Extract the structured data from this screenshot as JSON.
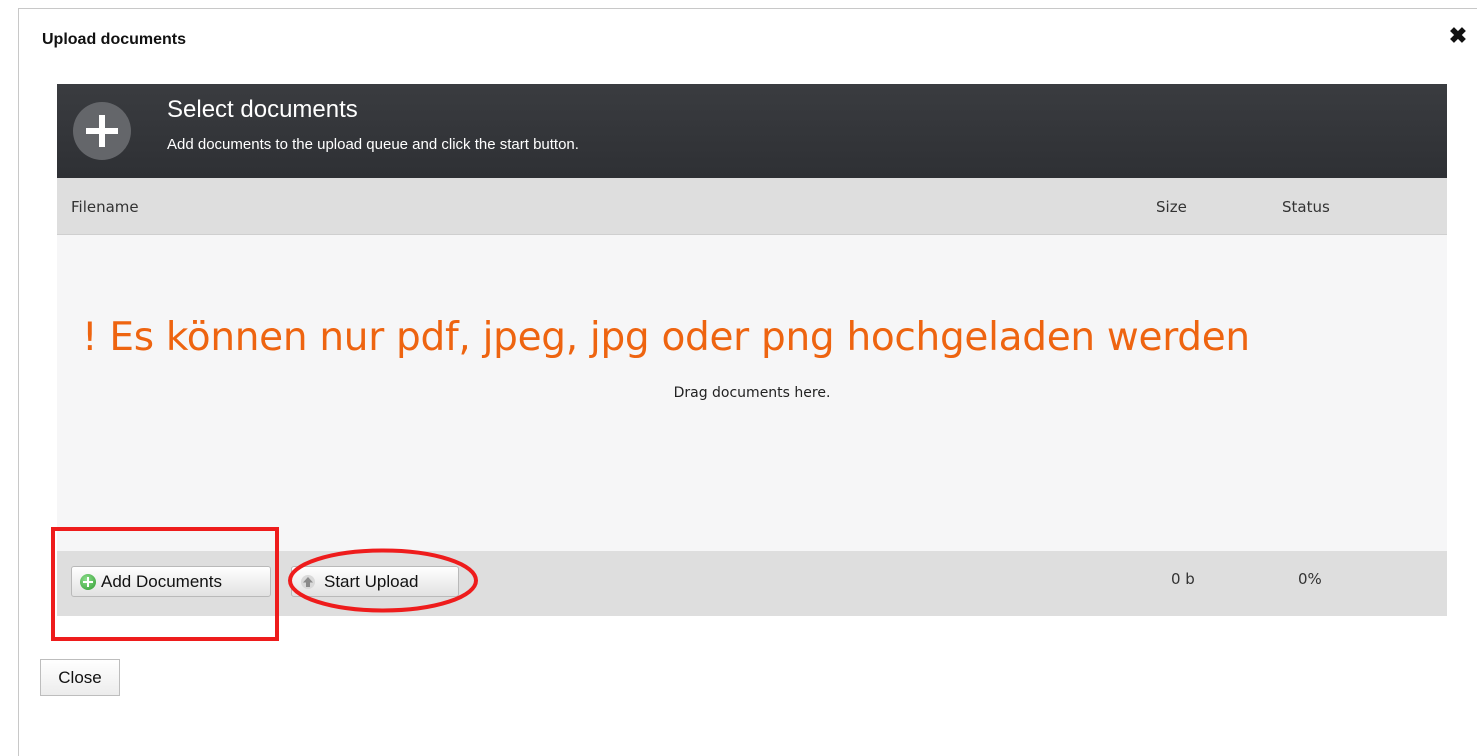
{
  "dialog": {
    "title": "Upload documents",
    "close_icon": "close-icon"
  },
  "uploader": {
    "header_icon": "plus-icon",
    "title": "Select documents",
    "subtitle": "Add documents to the upload queue and click the start button.",
    "columns": {
      "filename": "Filename",
      "size": "Size",
      "status": "Status"
    },
    "warning": "! Es können nur pdf, jpeg, jpg oder png hochgeladen werden",
    "drag_hint": "Drag documents here.",
    "add_button": "Add Documents",
    "start_button": "Start Upload",
    "total_size": "0 b",
    "total_percent": "0%"
  },
  "close_button": "Close",
  "colors": {
    "warning": "#ee6410",
    "annotation": "#ee1c1c",
    "header_bg": "#333539"
  }
}
